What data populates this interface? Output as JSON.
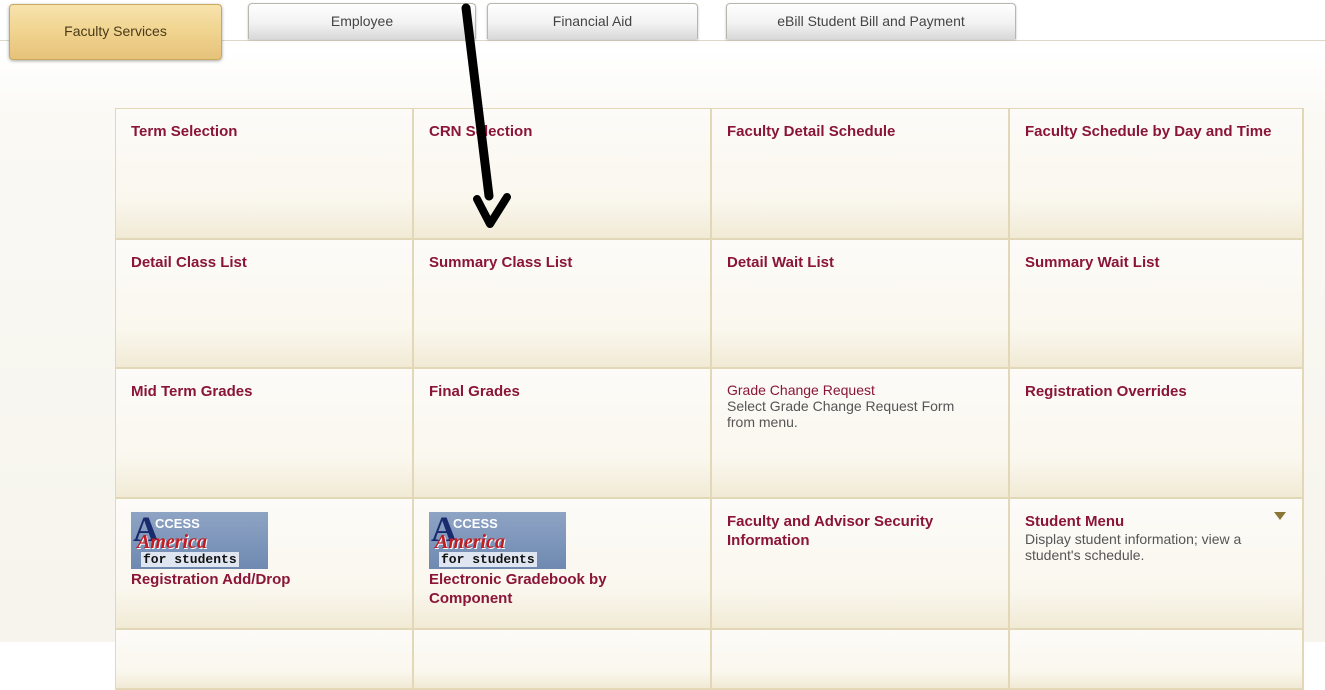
{
  "tabs": [
    {
      "label": "Faculty Services"
    },
    {
      "label": "Employee"
    },
    {
      "label": "Financial Aid"
    },
    {
      "label": "eBill Student Bill and Payment"
    }
  ],
  "menu": {
    "term_selection": "Term Selection",
    "crn_selection": "CRN Selection",
    "faculty_detail_schedule": "Faculty Detail Schedule",
    "faculty_schedule_day_time": "Faculty Schedule by Day and Time",
    "detail_class_list": "Detail Class List",
    "summary_class_list": "Summary Class List",
    "detail_wait_list": "Detail Wait List",
    "summary_wait_list": "Summary Wait List",
    "mid_term_grades": "Mid Term Grades",
    "final_grades": "Final Grades",
    "grade_change_request": "Grade Change Request",
    "grade_change_request_desc": "Select Grade Change Request Form from menu.",
    "registration_overrides": "Registration Overrides",
    "registration_add_drop": "Registration Add/Drop",
    "electronic_gradebook": "Electronic Gradebook by Component",
    "faculty_advisor_security": "Faculty and Advisor Security Information",
    "student_menu": "Student Menu",
    "student_menu_desc": "Display student information; view a student's schedule."
  },
  "logo": {
    "line1_letter": "A",
    "line1_rest": "CCESS",
    "line2": "America",
    "line3": "for students"
  },
  "colors": {
    "link": "#8a1538",
    "active_tab": "#f1d591",
    "cell_border": "#e2d7b6"
  }
}
